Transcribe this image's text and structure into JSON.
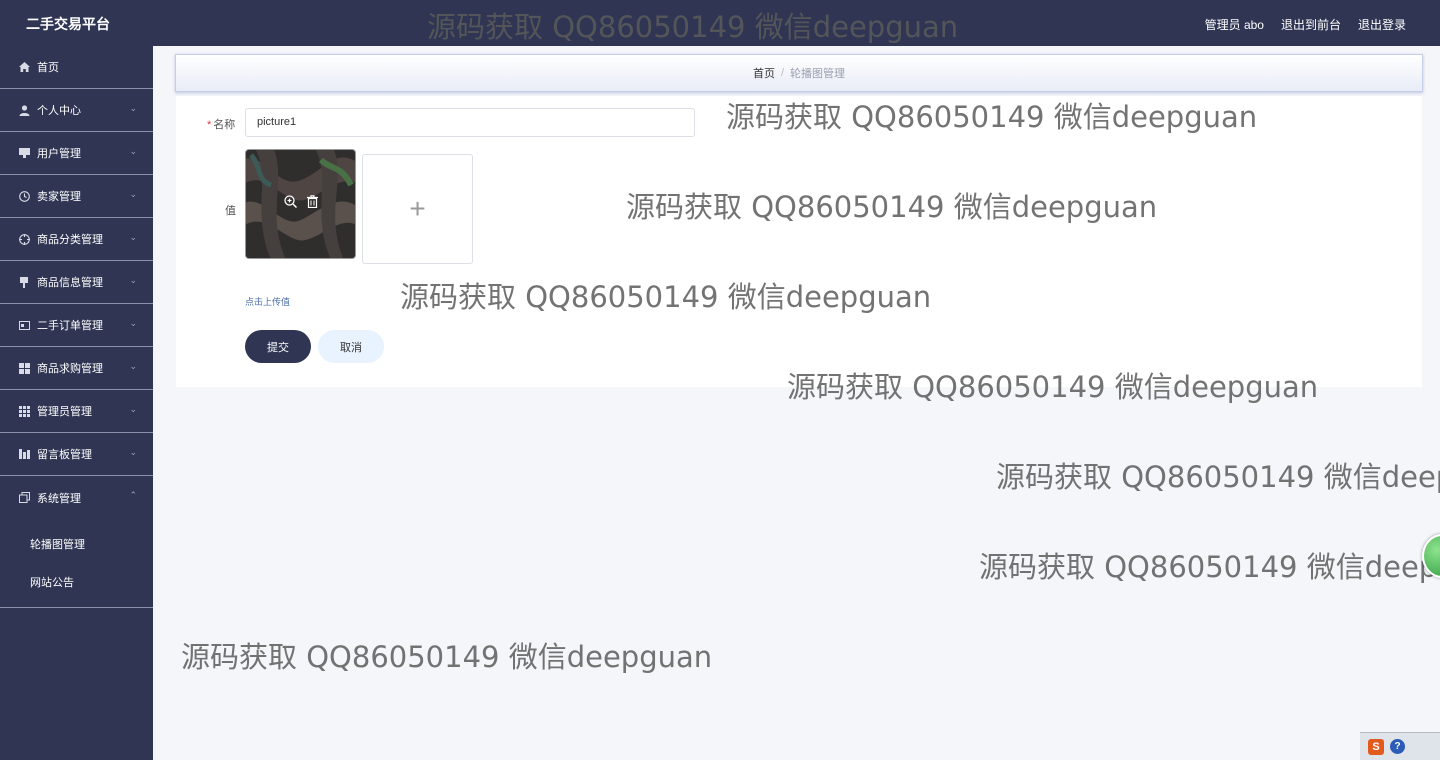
{
  "header": {
    "brand": "二手交易平台",
    "admin_label": "管理员 abo",
    "back_to_front": "退出到前台",
    "logout": "退出登录"
  },
  "sidebar": {
    "items": [
      {
        "label": "首页",
        "icon": "home-icon"
      },
      {
        "label": "个人中心",
        "icon": "user-icon"
      },
      {
        "label": "用户管理",
        "icon": "monitor-icon"
      },
      {
        "label": "卖家管理",
        "icon": "clock-icon"
      },
      {
        "label": "商品分类管理",
        "icon": "target-icon"
      },
      {
        "label": "商品信息管理",
        "icon": "pin-icon"
      },
      {
        "label": "二手订单管理",
        "icon": "card-icon"
      },
      {
        "label": "商品求购管理",
        "icon": "grid-icon"
      },
      {
        "label": "管理员管理",
        "icon": "apps-icon"
      },
      {
        "label": "留言板管理",
        "icon": "bars-icon"
      },
      {
        "label": "系统管理",
        "icon": "copy-icon"
      }
    ],
    "sub_items": [
      {
        "label": "轮播图管理"
      },
      {
        "label": "网站公告"
      }
    ]
  },
  "breadcrumb": {
    "home": "首页",
    "separator": "/",
    "current": "轮播图管理"
  },
  "form": {
    "name_label": "名称",
    "required_mark": "*",
    "name_value": "picture1",
    "value_label": "值",
    "upload_plus": "+",
    "upload_hint": "点击上传值",
    "submit": "提交",
    "cancel": "取消"
  },
  "watermark": "源码获取 QQ86050149 微信deepguan",
  "colors": {
    "sidebar_bg": "#2f3553",
    "primary": "#2f3553",
    "cancel_bg": "#e8f3ff",
    "required": "#e4393c"
  }
}
